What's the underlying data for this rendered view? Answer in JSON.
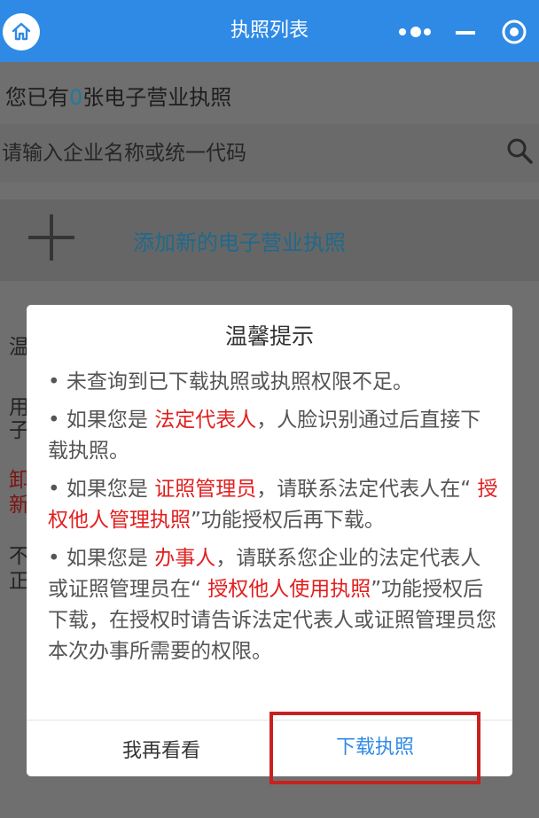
{
  "navbar": {
    "title": "执照列表",
    "home_icon": "home-icon",
    "more_icon": "more-dots-icon",
    "minimize_icon": "minimize-icon",
    "close_icon": "close-circle-icon",
    "color": "#2f8ae6"
  },
  "page": {
    "count_prefix": "您已有",
    "count_value": "0",
    "count_suffix": "张电子营业执照",
    "search_placeholder": "请输入企业名称或统一代码",
    "add_label": "添加新的电子营业执照",
    "fragments": [
      "温",
      "用",
      "子",
      "卸",
      "新",
      "不",
      "正"
    ]
  },
  "modal": {
    "title": "温馨提示",
    "item1": "• 未查询到已下载执照或执照权限不足。",
    "item2_a": "• 如果您是 ",
    "item2_role": "法定代表人",
    "item2_b": "，人脸识别通过后直接下载执照。",
    "item3_a": "• 如果您是 ",
    "item3_role": "证照管理员",
    "item3_b": "，请联系法定代表人在“ ",
    "item3_func": "授权他人管理执照",
    "item3_c": "”功能授权后再下载。",
    "item4_a": "• 如果您是 ",
    "item4_role": "办事人",
    "item4_b": "，请联系您企业的法定代表人或证照管理员在“ ",
    "item4_func": "授权他人使用执照",
    "item4_c": "”功能授权后下载，在授权时请告诉法定代表人或证照管理员您本次办事所需要的权限。",
    "cancel_label": "我再看看",
    "download_label": "下载执照",
    "highlight_color": "#e02020",
    "annotation_color": "#c8211f"
  }
}
